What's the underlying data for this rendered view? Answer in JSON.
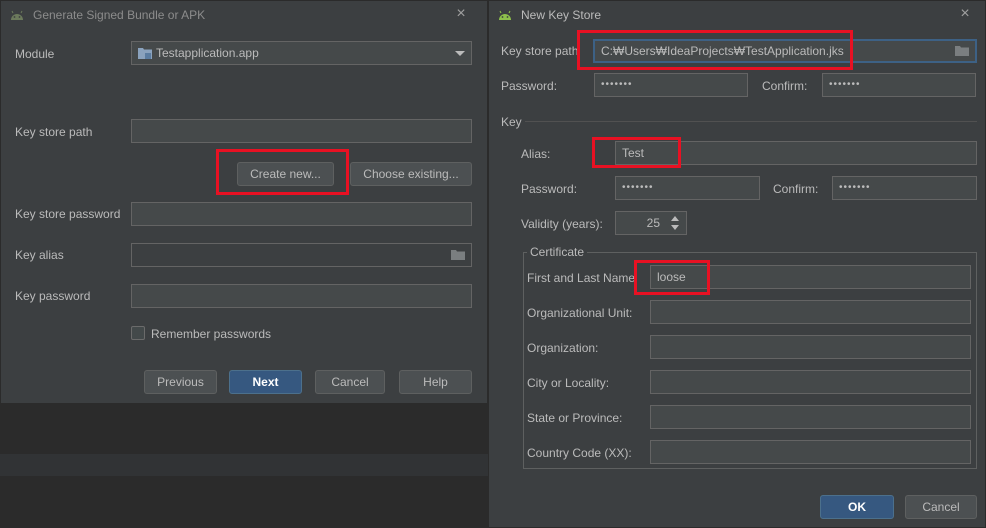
{
  "bundle_dialog": {
    "title": "Generate Signed Bundle or APK",
    "module_label": "Module",
    "module_value": "Testapplication.app",
    "key_store_path_label": "Key store path",
    "key_store_path_value": "",
    "create_new_label": "Create new...",
    "choose_existing_label": "Choose existing...",
    "key_store_password_label": "Key store password",
    "key_alias_label": "Key alias",
    "key_password_label": "Key password",
    "remember_passwords_label": "Remember passwords",
    "previous_label": "Previous",
    "next_label": "Next",
    "cancel_label": "Cancel",
    "help_label": "Help"
  },
  "keystore_dialog": {
    "title": "New Key Store",
    "key_store_path_label": "Key store path",
    "key_store_path_value": "C:₩Users₩IdeaProjects₩TestApplication.jks",
    "password_label": "Password:",
    "password_value": "•••••••",
    "confirm_label": "Confirm:",
    "confirm_value": "•••••••",
    "key_section_label": "Key",
    "alias_label": "Alias:",
    "alias_value": "Test",
    "key_password_label": "Password:",
    "key_password_value": "•••••••",
    "key_confirm_label": "Confirm:",
    "key_confirm_value": "•••••••",
    "validity_label": "Validity (years):",
    "validity_value": "25",
    "certificate_label": "Certificate",
    "first_last_label": "First and Last Name",
    "first_last_value": "loose",
    "org_unit_label": "Organizational Unit:",
    "org_label": "Organization:",
    "city_label": "City or Locality:",
    "state_label": "State or Province:",
    "country_label": "Country Code (XX):",
    "ok_label": "OK",
    "cancel_label": "Cancel"
  },
  "icons": {
    "close": "×",
    "android": "android-icon",
    "folder": "folder-icon"
  },
  "colors": {
    "highlight": "#e81123",
    "primary_button": "#365880",
    "dialog_bg": "#3c3f41"
  }
}
